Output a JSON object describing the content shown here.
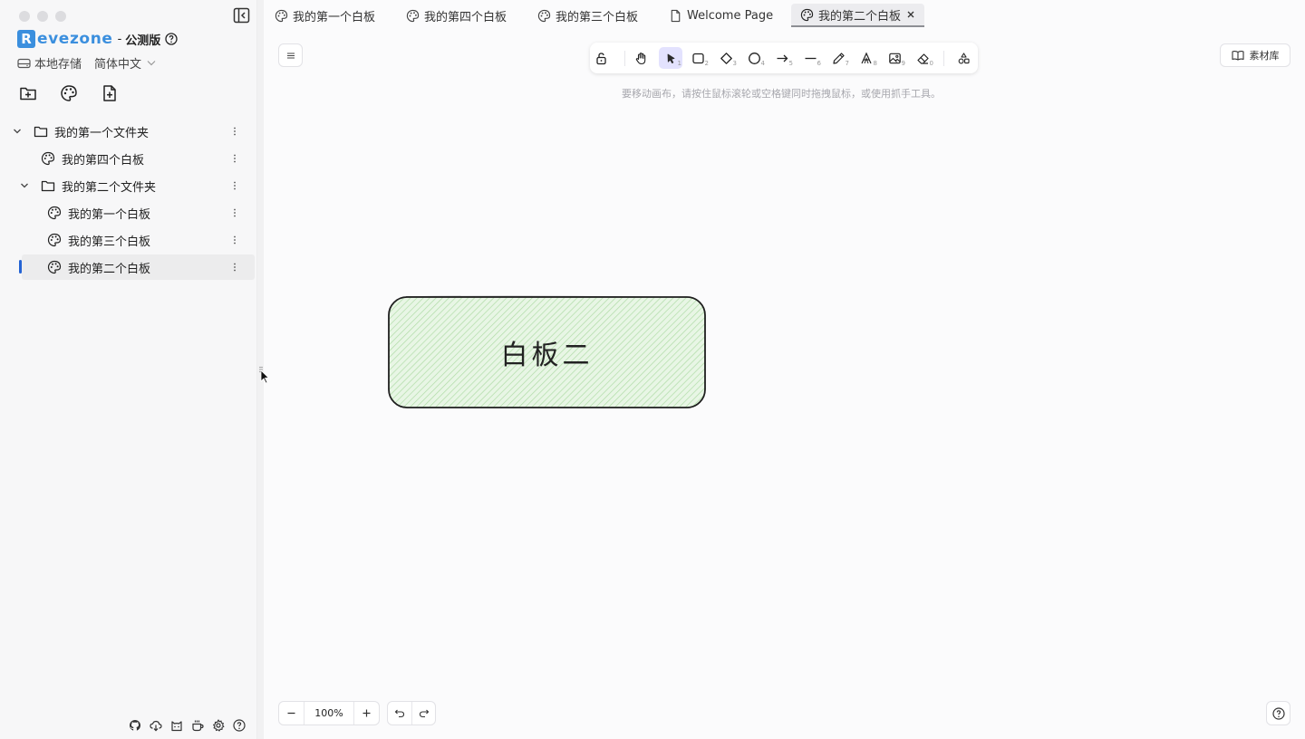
{
  "app": {
    "brand_initial": "R",
    "brand_rest": "evezone",
    "brand_dash": "-",
    "edition": "公测版",
    "storage_label": "本地存储",
    "language_label": "简体中文",
    "accent_color": "#3b8fde"
  },
  "sidebar": {
    "quick_actions": [
      {
        "name": "add-folder",
        "icon": "folder-plus-icon"
      },
      {
        "name": "add-board",
        "icon": "palette-icon"
      },
      {
        "name": "add-note",
        "icon": "file-plus-icon"
      }
    ],
    "tree": [
      {
        "label": "我的第一个文件夹",
        "type": "folder",
        "expanded": true,
        "level": 0
      },
      {
        "label": "我的第四个白板",
        "type": "board",
        "level": 1
      },
      {
        "label": "我的第二个文件夹",
        "type": "folder",
        "expanded": true,
        "level": 1
      },
      {
        "label": "我的第一个白板",
        "type": "board",
        "level": 2
      },
      {
        "label": "我的第三个白板",
        "type": "board",
        "level": 2
      },
      {
        "label": "我的第二个白板",
        "type": "board",
        "level": 2,
        "active": true
      }
    ],
    "footer_icons": [
      "github-icon",
      "cloud-download-icon",
      "cat-icon",
      "coffee-icon",
      "settings-icon",
      "help-icon"
    ]
  },
  "tabs": [
    {
      "label": "我的第一个白板",
      "icon": "palette-icon"
    },
    {
      "label": "我的第四个白板",
      "icon": "palette-icon"
    },
    {
      "label": "我的第三个白板",
      "icon": "palette-icon"
    },
    {
      "label": "Welcome Page",
      "icon": "file-icon"
    },
    {
      "label": "我的第二个白板",
      "icon": "palette-icon",
      "active": true
    }
  ],
  "toolbar": {
    "tools": [
      {
        "name": "lock",
        "key": ""
      },
      {
        "name": "hand",
        "key": ""
      },
      {
        "name": "selection",
        "key": "1",
        "selected": true
      },
      {
        "name": "rectangle",
        "key": "2"
      },
      {
        "name": "diamond",
        "key": "3"
      },
      {
        "name": "ellipse",
        "key": "4"
      },
      {
        "name": "arrow",
        "key": "5"
      },
      {
        "name": "line",
        "key": "6"
      },
      {
        "name": "pencil",
        "key": "7"
      },
      {
        "name": "text",
        "key": "8"
      },
      {
        "name": "image",
        "key": "9"
      },
      {
        "name": "eraser",
        "key": "0"
      },
      {
        "name": "more-shapes",
        "key": ""
      }
    ],
    "selected_color": "#e3e2fe"
  },
  "canvas": {
    "hint": "要移动画布，请按住鼠标滚轮或空格键同时拖拽鼠标，或使用抓手工具。",
    "library_label": "素材库",
    "shape_text": "白板二",
    "shape_fill": "#c9ebc4",
    "zoom": "100%"
  }
}
